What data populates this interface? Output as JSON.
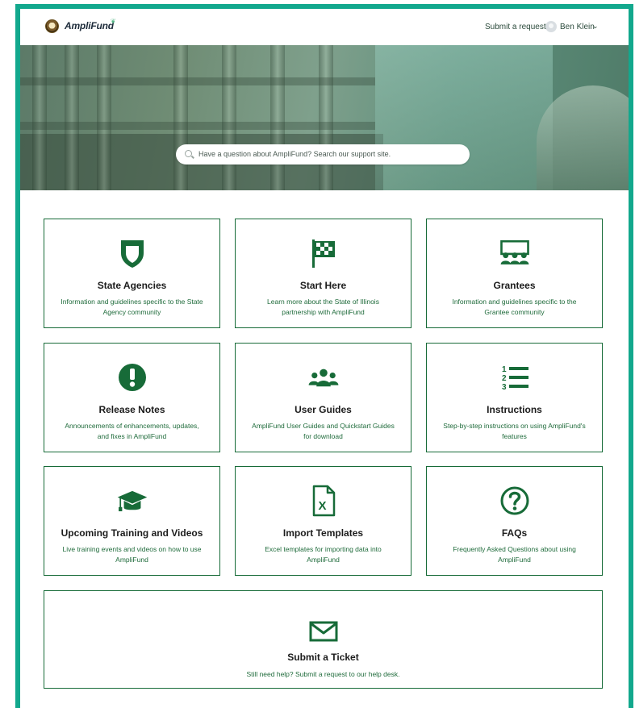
{
  "header": {
    "app_name": "AmpliFund",
    "submit_request_label": "Submit a request",
    "user_name": "Ben Klein",
    "user_menu_caret": "⌄"
  },
  "search": {
    "placeholder": "Have a question about AmpliFund? Search our support site."
  },
  "colors": {
    "accent_border": "#12a88d",
    "card_green": "#176b38"
  },
  "cards": [
    {
      "title": "State Agencies",
      "desc": "Information and guidelines specific to the State Agency community",
      "icon": "shield-icon"
    },
    {
      "title": "Start Here",
      "desc": "Learn more about the State of Illinois partnership with AmpliFund",
      "icon": "checkered-flag-icon"
    },
    {
      "title": "Grantees",
      "desc": "Information and guidelines specific to the Grantee community",
      "icon": "presentation-audience-icon"
    },
    {
      "title": "Release Notes",
      "desc": "Announcements of enhancements, updates, and fixes in AmpliFund",
      "icon": "exclamation-circle-icon"
    },
    {
      "title": "User Guides",
      "desc": "AmpliFund User Guides and Quickstart Guides for download",
      "icon": "users-group-icon"
    },
    {
      "title": "Instructions",
      "desc": "Step-by-step instructions on using AmpliFund's features",
      "icon": "numbered-list-icon"
    },
    {
      "title": "Upcoming Training and Videos",
      "desc": "Live training events and videos on how to use AmpliFund",
      "icon": "graduation-cap-icon"
    },
    {
      "title": "Import Templates",
      "desc": "Excel templates for importing data into AmpliFund",
      "icon": "excel-file-icon"
    },
    {
      "title": "FAQs",
      "desc": "Frequently Asked Questions about using AmpliFund",
      "icon": "question-circle-icon"
    },
    {
      "title": "Submit a Ticket",
      "desc": "Still need help? Submit a request to our help desk.",
      "icon": "envelope-icon"
    }
  ]
}
